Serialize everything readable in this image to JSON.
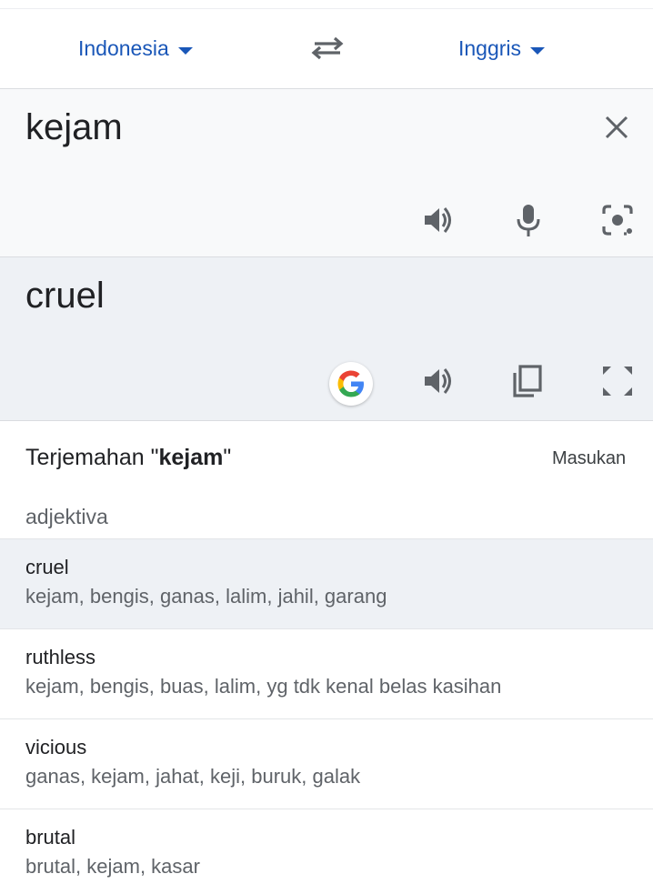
{
  "languages": {
    "source": "Indonesia",
    "target": "Inggris"
  },
  "input": {
    "text": "kejam"
  },
  "output": {
    "text": "cruel"
  },
  "dictionary": {
    "title_prefix": "Terjemahan \"",
    "title_word": "kejam",
    "title_suffix": "\"",
    "feedback_label": "Masukan",
    "part_of_speech": "adjektiva",
    "entries": [
      {
        "word": "cruel",
        "synonyms": "kejam, bengis, ganas, lalim, jahil, garang"
      },
      {
        "word": "ruthless",
        "synonyms": "kejam, bengis, buas, lalim, yg tdk kenal belas kasihan"
      },
      {
        "word": "vicious",
        "synonyms": "ganas, kejam, jahat, keji, buruk, galak"
      },
      {
        "word": "brutal",
        "synonyms": "brutal, kejam, kasar"
      }
    ]
  },
  "colors": {
    "accent": "#1a57b8",
    "icon": "#5f6368",
    "input_bg": "#f8f9fa",
    "output_bg": "#eef1f5"
  },
  "icons": [
    "chevron-down-icon",
    "swap-icon",
    "close-icon",
    "speaker-icon",
    "microphone-icon",
    "camera-icon",
    "google-icon",
    "copy-icon",
    "fullscreen-icon"
  ]
}
